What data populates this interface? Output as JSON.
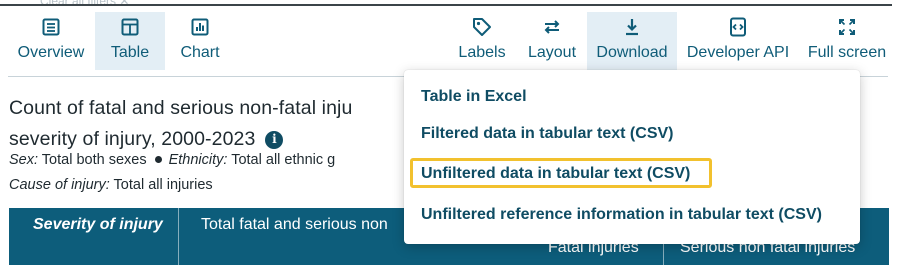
{
  "filters": {
    "clear_label": "Clear all filters"
  },
  "toolbar": {
    "overview": "Overview",
    "table": "Table",
    "chart": "Chart",
    "labels": "Labels",
    "layout": "Layout",
    "download": "Download",
    "developer_api": "Developer API",
    "full_screen": "Full screen"
  },
  "title": {
    "line1": "Count of fatal and serious non-fatal inju",
    "line2": "severity of injury, 2000-2023"
  },
  "meta": {
    "sex_label": "Sex:",
    "sex_value": "Total both sexes",
    "ethnicity_label": "Ethnicity:",
    "ethnicity_value": "Total all ethnic g",
    "cause_label": "Cause of injury:",
    "cause_value": "Total all injuries"
  },
  "table": {
    "col_severity": "Severity of injury",
    "col_total": "Total fatal and serious non",
    "col_fatal": "Fatal injuries",
    "col_serious": "Serious non fatal injuries"
  },
  "download_menu": {
    "items": [
      "Table in Excel",
      "Filtered data in tabular text (CSV)",
      "Unfiltered data in tabular text (CSV)",
      "Unfiltered reference information in tabular text (CSV)"
    ],
    "highlighted_index": 2
  },
  "colors": {
    "accent": "#0f5c78",
    "table_header": "#0d5d7b",
    "active_bg": "#e3eef5",
    "highlight_border": "#f2c12e"
  }
}
